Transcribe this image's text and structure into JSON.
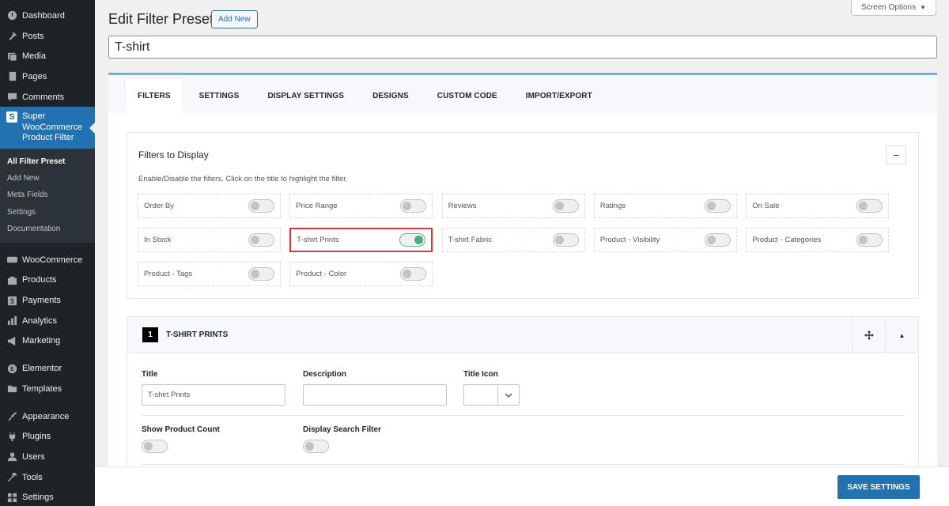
{
  "sidebar": {
    "items_top": [
      {
        "label": "Dashboard",
        "icon": "dashboard-icon"
      },
      {
        "label": "Posts",
        "icon": "pin-icon"
      },
      {
        "label": "Media",
        "icon": "media-icon"
      },
      {
        "label": "Pages",
        "icon": "pages-icon"
      },
      {
        "label": "Comments",
        "icon": "comment-icon"
      }
    ],
    "active": {
      "label": "Super WooCommerce Product Filter",
      "icon_letter": "S"
    },
    "submenu": [
      "All Filter Preset",
      "Add New",
      "Meta Fields",
      "Settings",
      "Documentation"
    ],
    "items_mid": [
      {
        "label": "WooCommerce",
        "icon": "woo-icon"
      },
      {
        "label": "Products",
        "icon": "products-icon"
      },
      {
        "label": "Payments",
        "icon": "payments-icon"
      },
      {
        "label": "Analytics",
        "icon": "analytics-icon"
      },
      {
        "label": "Marketing",
        "icon": "megaphone-icon"
      }
    ],
    "items_el": [
      {
        "label": "Elementor",
        "icon": "elementor-icon"
      },
      {
        "label": "Templates",
        "icon": "folder-icon"
      }
    ],
    "items_bottom": [
      {
        "label": "Appearance",
        "icon": "brush-icon"
      },
      {
        "label": "Plugins",
        "icon": "plugin-icon"
      },
      {
        "label": "Users",
        "icon": "user-icon"
      },
      {
        "label": "Tools",
        "icon": "wrench-icon"
      },
      {
        "label": "Settings",
        "icon": "settings-icon"
      }
    ]
  },
  "header": {
    "title": "Edit Filter Preset",
    "add_new": "Add New",
    "screen_options": "Screen Options",
    "preset_name": "T-shirt"
  },
  "tabs": [
    "FILTERS",
    "SETTINGS",
    "DISPLAY SETTINGS",
    "DESIGNS",
    "CUSTOM CODE",
    "IMPORT/EXPORT"
  ],
  "filters_box": {
    "title": "Filters to Display",
    "collapse": "−",
    "description": "Enable/Disable the filters. Click on the title to highlight the filter.",
    "filters": [
      {
        "label": "Order By",
        "enabled": false
      },
      {
        "label": "Price Range",
        "enabled": false
      },
      {
        "label": "Reviews",
        "enabled": false
      },
      {
        "label": "Ratings",
        "enabled": false
      },
      {
        "label": "On Sale",
        "enabled": false
      },
      {
        "label": "In Stock",
        "enabled": false
      },
      {
        "label": "T-shirt Prints",
        "enabled": true,
        "highlighted": true
      },
      {
        "label": "T-shirt Fabric",
        "enabled": false
      },
      {
        "label": "Product - Visibility",
        "enabled": false
      },
      {
        "label": "Product - Categories",
        "enabled": false
      },
      {
        "label": "Product - Tags",
        "enabled": false
      },
      {
        "label": "Product - Color",
        "enabled": false
      }
    ]
  },
  "section": {
    "number": "1",
    "title": "T-SHIRT PRINTS",
    "title_label": "Title",
    "title_value": "T-shirt Prints",
    "description_label": "Description",
    "description_value": "",
    "title_icon_label": "Title Icon",
    "show_count_label": "Show Product Count",
    "search_filter_label": "Display Search Filter"
  },
  "footer": {
    "save": "SAVE SETTINGS"
  },
  "colors": {
    "accent": "#2271b1",
    "toggle_on": "#4cae7f",
    "highlight": "#d63638",
    "sidebar_bg": "#1d2327"
  }
}
